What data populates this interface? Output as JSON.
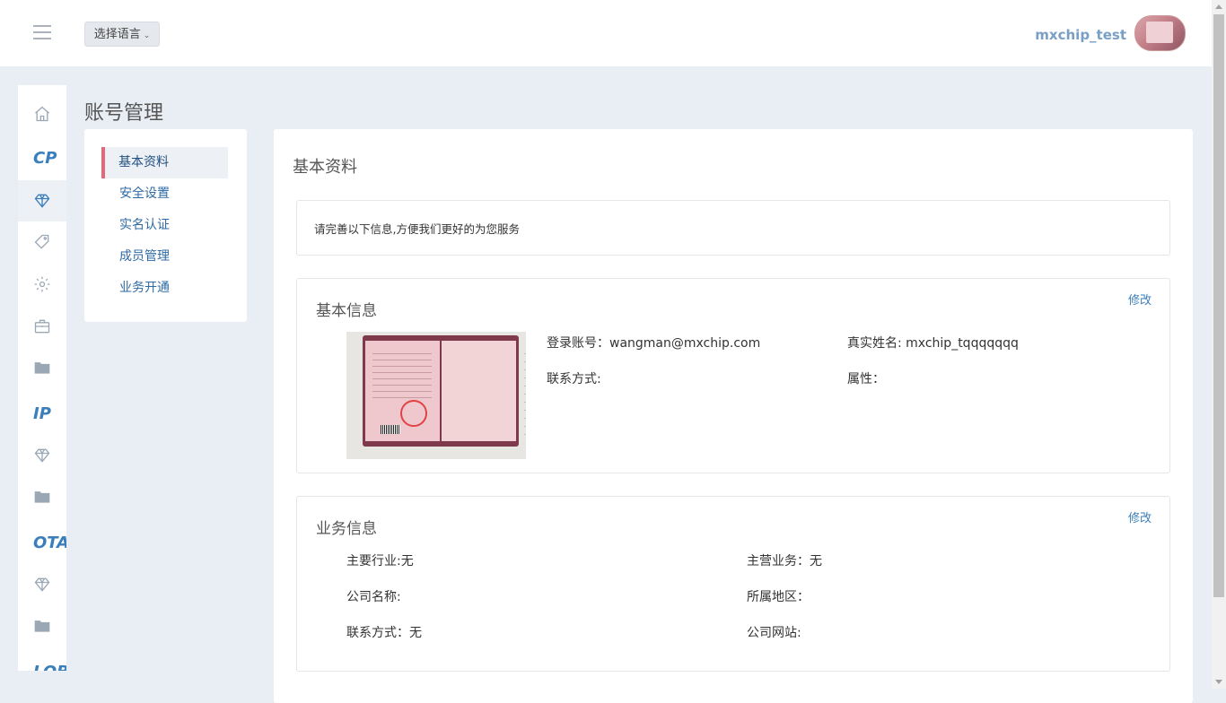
{
  "header": {
    "language_button": "选择语言",
    "username": "mxchip_test"
  },
  "iconbar": {
    "sections": [
      "CP",
      "IP",
      "OTA",
      "LOB"
    ]
  },
  "page_title": "账号管理",
  "submenu": {
    "items": [
      "基本资料",
      "安全设置",
      "实名认证",
      "成员管理",
      "业务开通"
    ]
  },
  "main": {
    "title": "基本资料",
    "notice": "请完善以下信息,方便我们更好的为您服务",
    "basic_info": {
      "title": "基本信息",
      "edit": "修改",
      "login_account": "登录账号：wangman@mxchip.com",
      "real_name": "真实姓名: mxchip_tqqqqqqq",
      "contact": "联系方式:",
      "attribute": "属性："
    },
    "business_info": {
      "title": "业务信息",
      "edit": "修改",
      "industry": "主要行业:无",
      "main_business": "主营业务：无",
      "company_name": "公司名称:",
      "region": "所属地区：",
      "contact": "联系方式：无",
      "website": "公司网站:"
    }
  },
  "colors": {
    "accent": "#3a7ebc",
    "active_marker": "#e8667a",
    "background": "#e9edf4"
  }
}
